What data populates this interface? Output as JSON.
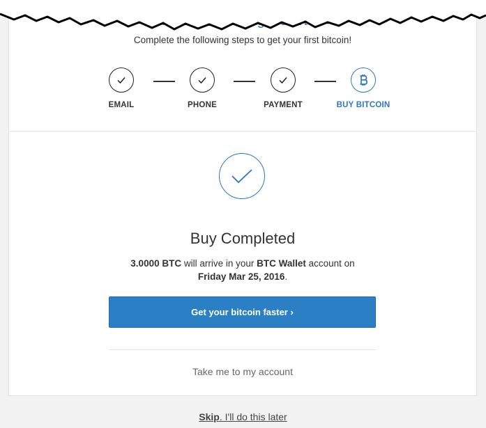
{
  "header": {
    "welcome_text": "Welcome        - Let's get started ›",
    "subtitle": "Complete the following steps to get your first bitcoin!"
  },
  "steps": [
    {
      "label": "EMAIL",
      "status": "done",
      "icon": "check-icon"
    },
    {
      "label": "PHONE",
      "status": "done",
      "icon": "check-icon"
    },
    {
      "label": "PAYMENT",
      "status": "done",
      "icon": "check-icon"
    },
    {
      "label": "BUY BITCOIN",
      "status": "active",
      "icon": "bitcoin-icon"
    }
  ],
  "result": {
    "title": "Buy Completed",
    "amount": "3.0000 BTC",
    "text_mid": " will arrive in your ",
    "wallet": "BTC Wallet",
    "text_after": " account on",
    "date": "Friday Mar 25, 2016",
    "date_suffix": "."
  },
  "actions": {
    "primary_label": "Get your bitcoin faster ›",
    "account_link": "Take me to my account"
  },
  "footer": {
    "skip_word": "Skip",
    "skip_rest": ". I'll do this later"
  },
  "colors": {
    "accent": "#2b77c1",
    "button": "#2b7fc4",
    "background": "#f2f2f2"
  }
}
